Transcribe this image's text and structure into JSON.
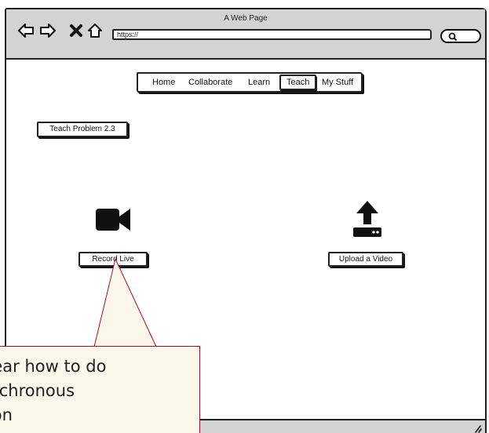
{
  "window": {
    "title": "A Web Page",
    "url": "https://"
  },
  "toolbar": {
    "icons": [
      "back-icon",
      "forward-icon",
      "close-icon",
      "home-icon",
      "search-icon"
    ]
  },
  "navbar": {
    "items": [
      {
        "label": "Home",
        "active": false
      },
      {
        "label": "Collaborate",
        "active": false
      },
      {
        "label": "Learn",
        "active": false
      },
      {
        "label": "Teach",
        "active": true
      },
      {
        "label": "My Stuff",
        "active": false
      }
    ]
  },
  "main": {
    "problem_button": "Teach Problem 2.3",
    "record_button": "Record Live",
    "upload_button": "Upload a Video",
    "icons": [
      "video-camera-icon",
      "upload-icon"
    ]
  },
  "callout": {
    "text": "clear how to do\nynchronous\nsion",
    "background": "#fdf6ea",
    "border": "#a01030"
  }
}
